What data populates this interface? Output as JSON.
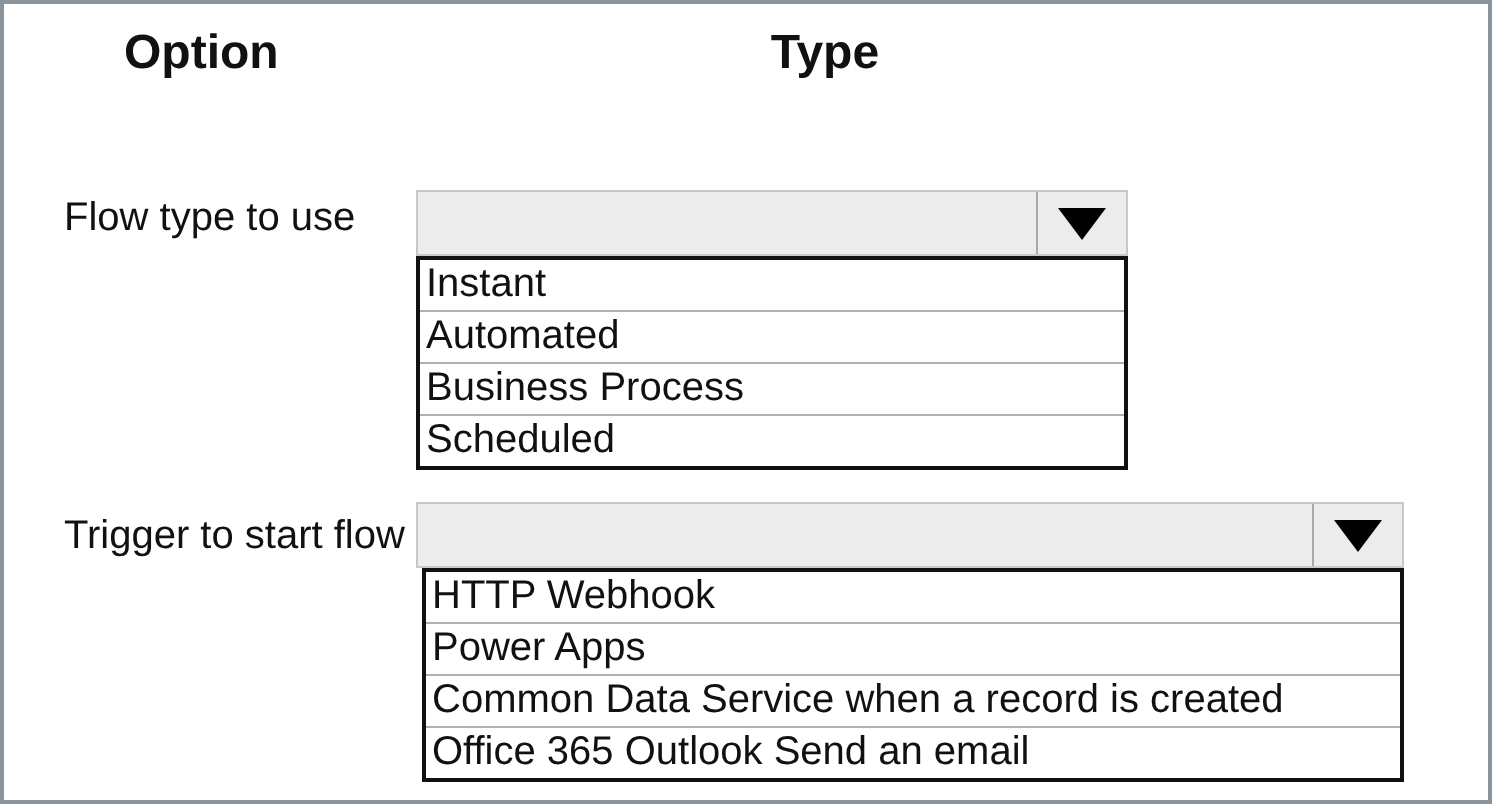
{
  "headers": [
    "Option",
    "Type"
  ],
  "rows": [
    {
      "label": "Flow type to use",
      "options": [
        "Instant",
        "Automated",
        "Business Process",
        "Scheduled"
      ]
    },
    {
      "label": "Trigger to start flow",
      "options": [
        "HTTP Webhook",
        "Power Apps",
        "Common Data Service when a record is created",
        "Office 365 Outlook Send an email"
      ]
    }
  ]
}
